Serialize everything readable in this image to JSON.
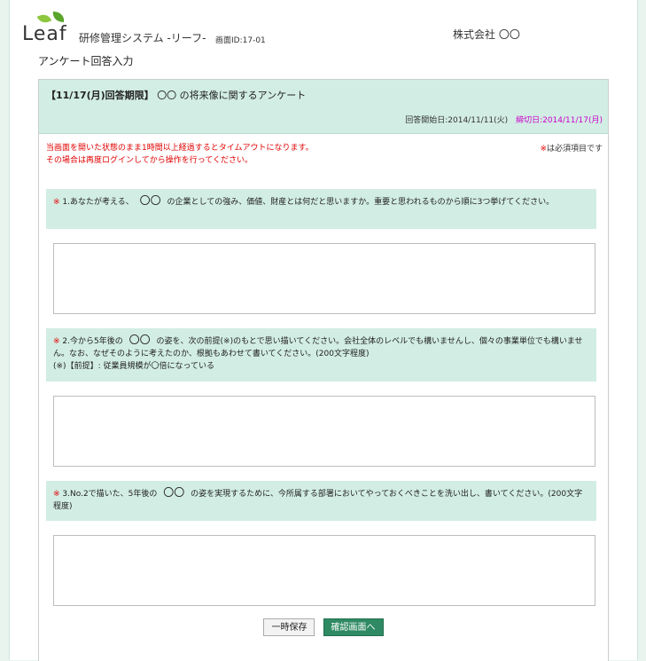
{
  "header": {
    "logo_text": "Leaf",
    "system_title": "研修管理システム -リーフ-",
    "screen_id": "画面ID:17-01",
    "company": "株式会社 〇〇",
    "page_heading": "アンケート回答入力"
  },
  "survey": {
    "deadline_tag": "【11/17(月)回答期限】",
    "title": "〇〇 の将来像に関するアンケート",
    "start_label": "回答開始日:2014/11/11(火)",
    "deadline_label": "締切日:2014/11/17(月)"
  },
  "notice": {
    "line1": "当画面を開いた状態のまま1時間以上経過するとタイムアウトになります。",
    "line2": "その場合は再度ログインしてから操作を行ってください。",
    "required_star": "※",
    "required_text": "は必須項目です"
  },
  "questions": [
    {
      "star": "※",
      "prefix": "1.あなたが考える、",
      "maru": "〇〇",
      "text": "の企業としての強み、価値、財産とは何だと思いますか。重要と思われるものから順に3つ挙げてください。",
      "extra": ""
    },
    {
      "star": "※",
      "prefix": "2.今から5年後の",
      "maru": "〇〇",
      "text": "の姿を、次の前提(※)のもとで思い描いてください。会社全体のレベルでも構いませんし、個々の事業単位でも構いません。なお、なぜそのように考えたのか、根拠もあわせて書いてください。(200文字程度)",
      "extra": "(※)【前提】: 従業員規模が〇倍になっている"
    },
    {
      "star": "※",
      "prefix": "3.No.2で描いた、5年後の",
      "maru": "〇〇",
      "text": "の姿を実現するために、今所属する部署においてやっておくべきことを洗い出し、書いてください。(200文字程度)",
      "extra": ""
    }
  ],
  "buttons": {
    "save": "一時保存",
    "confirm": "確認画面へ"
  }
}
